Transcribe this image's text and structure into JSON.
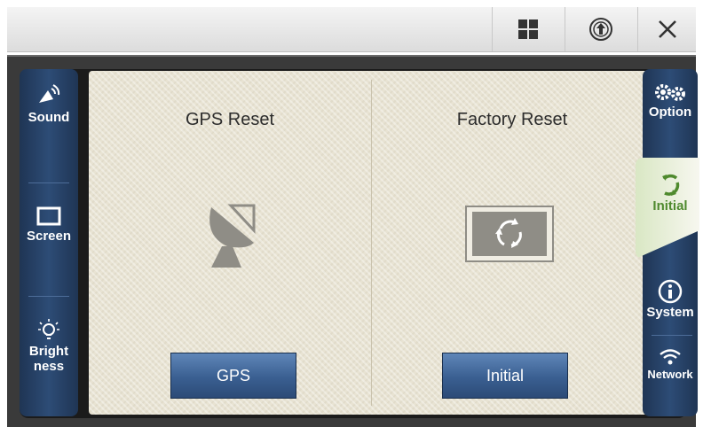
{
  "left_nav": {
    "items": [
      {
        "label": "Sound",
        "icon": "speaker-icon"
      },
      {
        "label": "Screen",
        "icon": "screen-icon"
      },
      {
        "label_line1": "Bright",
        "label_line2": "ness",
        "icon": "lightbulb-icon"
      }
    ]
  },
  "right_nav": {
    "items": [
      {
        "label": "Option",
        "icon": "gears-icon"
      },
      {
        "label": "Initial",
        "icon": "refresh-icon",
        "active": true
      },
      {
        "label": "System",
        "icon": "info-icon"
      },
      {
        "label": "Network",
        "icon": "wifi-icon"
      }
    ]
  },
  "gps_section": {
    "title": "GPS Reset",
    "button_label": "GPS"
  },
  "factory_section": {
    "title": "Factory Reset",
    "button_label": "Initial"
  },
  "colors": {
    "nav_blue": "#2d4c76",
    "button_blue": "#3a5f91",
    "active_green": "#4f8a2e",
    "panel": "#e8e3d3"
  }
}
